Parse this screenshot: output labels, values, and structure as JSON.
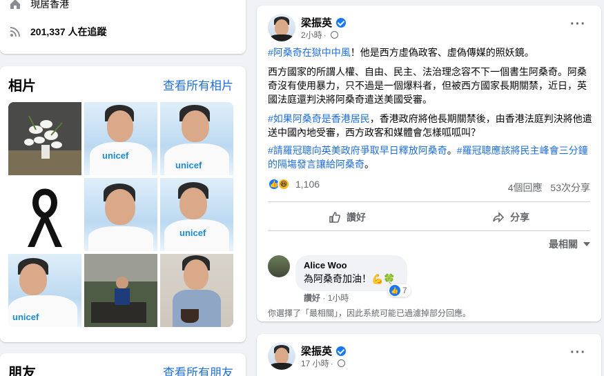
{
  "intro": {
    "lives_in": "現居香港",
    "followers": "201,337 人在追蹤"
  },
  "photos": {
    "title": "相片",
    "see_all": "查看所有相片",
    "unicef_text": "unicef"
  },
  "friends": {
    "title": "朋友",
    "see_all": "查看所有朋友"
  },
  "post": {
    "author": "梁振英",
    "time": "2小時",
    "line1_tag": "#阿桑奇在獄中中風",
    "line1_rest": "！他是西方虛偽政客、虛偽傳媒的照妖鏡。",
    "para2": "西方國家的所謂人權、自由、民主、法治理念容不下一個書生阿桑奇。阿桑奇沒有使用暴力，只不過是一個爆料者，但被西方國家長期關禁，近日，英國法庭還判決將阿桑奇遣送美國受審。",
    "para3_tag": "#如果阿桑奇是香港居民",
    "para3_rest": "，香港政府將他長期關禁後，由香港法庭判決將他遣送中國內地受審，西方政客和媒體會怎樣呱呱叫？",
    "tag4a": "#請羅冠聰向英美政府爭取早日釋放阿桑奇",
    "tag4_sep": "。",
    "tag4b": "#羅冠聰應該將民主峰會三分鐘的隔塲發言讓給阿桑奇",
    "tag4_end": "。",
    "reaction_count": "1,106",
    "comments_count": "4個回應",
    "shares_count": "53次分享",
    "like_label": "讚好",
    "share_label": "分享",
    "sort_label": "最相關"
  },
  "comment": {
    "name": "Alice Woo",
    "text": "為阿桑奇加油！💪🍀",
    "reaction_count": "7",
    "like": "讚好",
    "time": "1小時"
  },
  "filter_note": "你選擇了「最相關」，因此系統可能已過濾掉部分回應。",
  "post2": {
    "author": "梁振英",
    "time": "17 小時"
  },
  "colors": {
    "link": "#216fdb",
    "like_blue": "#1877f2",
    "background": "#f0f2f5"
  }
}
